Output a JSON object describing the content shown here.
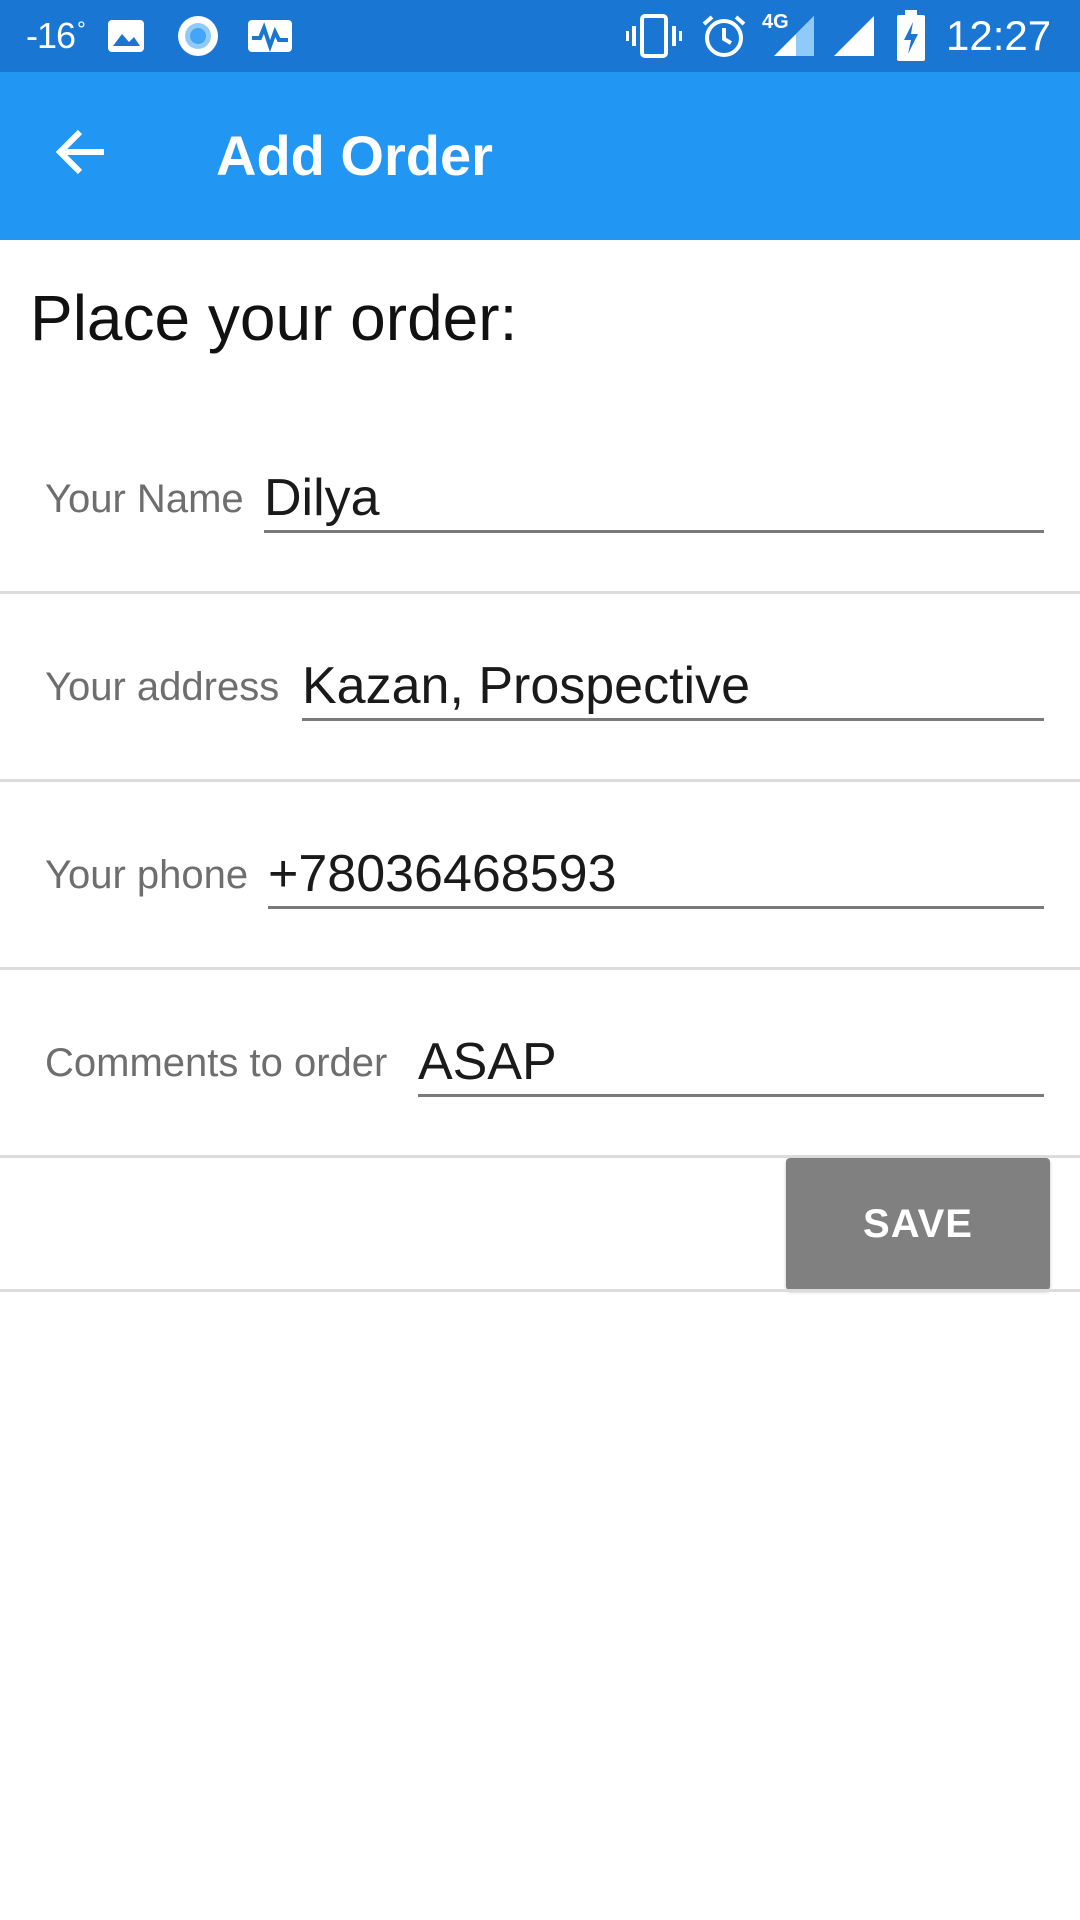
{
  "status_bar": {
    "temperature": "-16",
    "temperature_unit": "°",
    "network_type": "4G",
    "time": "12:27",
    "icons": [
      "image-icon",
      "circle-record-icon",
      "activity-icon",
      "vibrate-icon",
      "alarm-icon",
      "signal-4g-icon",
      "signal-icon",
      "battery-charging-icon"
    ]
  },
  "app_bar": {
    "title": "Add Order",
    "back_icon": "arrow-back-icon"
  },
  "page": {
    "heading": "Place your order:"
  },
  "form": {
    "name": {
      "label": "Your Name",
      "value": "Dilya"
    },
    "address": {
      "label": "Your address",
      "value": "Kazan, Prospective"
    },
    "phone": {
      "label": "Your phone",
      "value": "+78036468593"
    },
    "comments": {
      "label": "Comments to order",
      "value": "ASAP"
    }
  },
  "actions": {
    "save_label": "SAVE"
  },
  "colors": {
    "status_bar": "#1976d2",
    "app_bar": "#2196f3",
    "save_button": "#808080"
  }
}
